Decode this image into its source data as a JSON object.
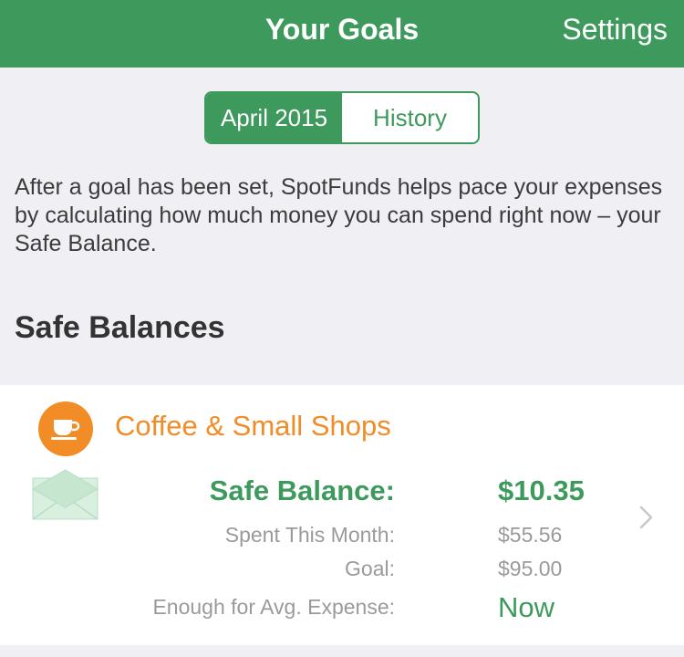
{
  "header": {
    "title": "Your Goals",
    "settings_label": "Settings"
  },
  "segments": {
    "month_label": "April 2015",
    "history_label": "History"
  },
  "intro_text": "After a goal has been set, SpotFunds helps pace your expenses by calculating how much money you can spend right now – your Safe Balance.",
  "section_title": "Safe Balances",
  "category": {
    "name": "Coffee & Small Shops",
    "icon": "coffee-cup-icon",
    "rows": {
      "safe_balance_label": "Safe Balance:",
      "safe_balance_value": "$10.35",
      "spent_label": "Spent This Month:",
      "spent_value": "$55.56",
      "goal_label": "Goal:",
      "goal_value": "$95.00",
      "enough_label": "Enough for Avg. Expense:",
      "enough_value": "Now"
    }
  },
  "colors": {
    "brand_green": "#3d9a5c",
    "category_orange": "#f28c26",
    "background": "#efeff4"
  }
}
